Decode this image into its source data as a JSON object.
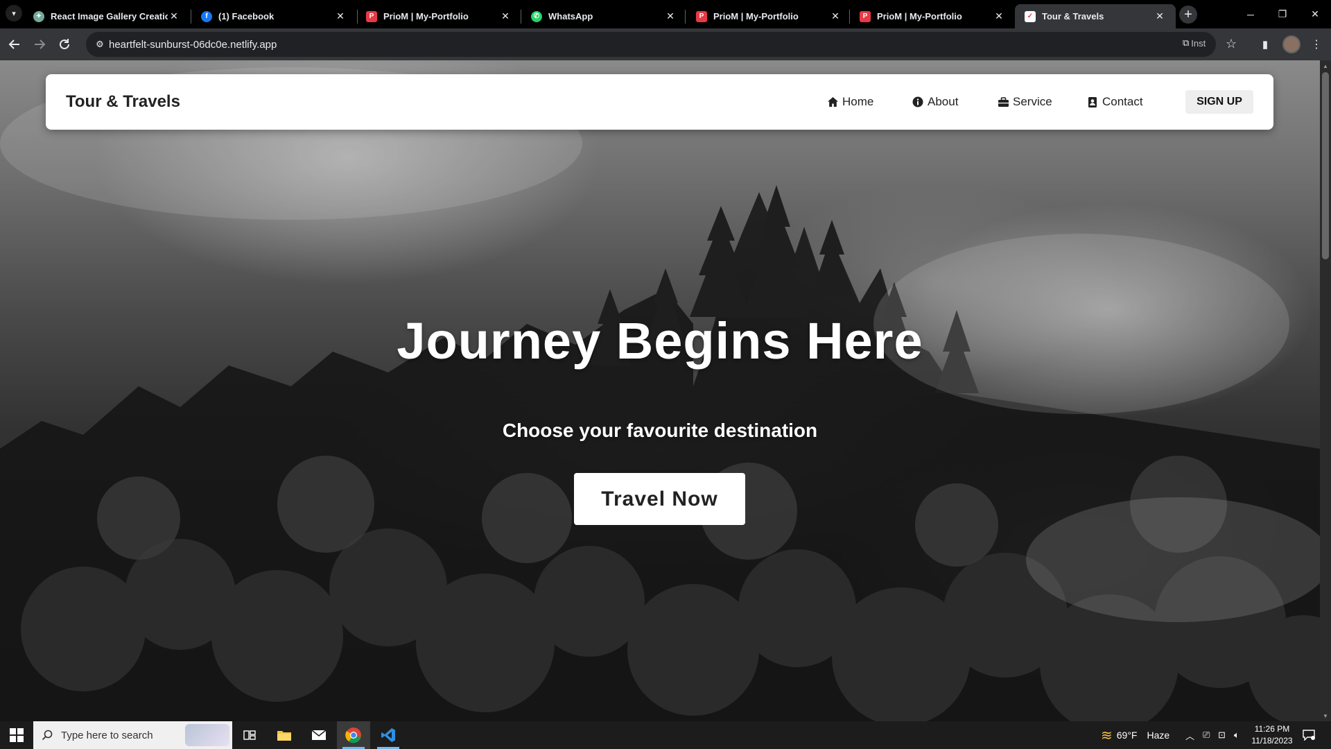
{
  "browser": {
    "tabs": [
      {
        "title": "React Image Gallery Creation",
        "icon": "chatgpt-icon",
        "color": "#74aa9c"
      },
      {
        "title": "(1) Facebook",
        "icon": "facebook-icon",
        "color": "#1877f2"
      },
      {
        "title": "PrioM | My-Portfolio",
        "icon": "portfolio-icon",
        "color": "#e63946"
      },
      {
        "title": "WhatsApp",
        "icon": "whatsapp-icon",
        "color": "#25d366"
      },
      {
        "title": "PrioM | My-Portfolio",
        "icon": "portfolio-icon",
        "color": "#e63946"
      },
      {
        "title": "PrioM | My-Portfolio",
        "icon": "portfolio-icon",
        "color": "#e63946"
      },
      {
        "title": "Tour & Travels",
        "icon": "tour-icon",
        "color": "#e63946"
      }
    ],
    "url": "heartfelt-sunburst-06dc0e.netlify.app",
    "install_label": "Inst"
  },
  "site": {
    "brand": "Tour & Travels",
    "nav": [
      {
        "label": "Home",
        "icon": "home-icon"
      },
      {
        "label": "About",
        "icon": "info-icon"
      },
      {
        "label": "Service",
        "icon": "briefcase-icon"
      },
      {
        "label": "Contact",
        "icon": "contact-icon"
      }
    ],
    "signup_label": "SIGN UP",
    "hero_title": "Journey Begins Here",
    "hero_subtitle": "Choose your favourite destination",
    "cta_label": "Travel Now"
  },
  "taskbar": {
    "search_placeholder": "Type here to search",
    "weather_temp": "69°F",
    "weather_desc": "Haze",
    "time": "11:26 PM",
    "date": "11/18/2023"
  }
}
